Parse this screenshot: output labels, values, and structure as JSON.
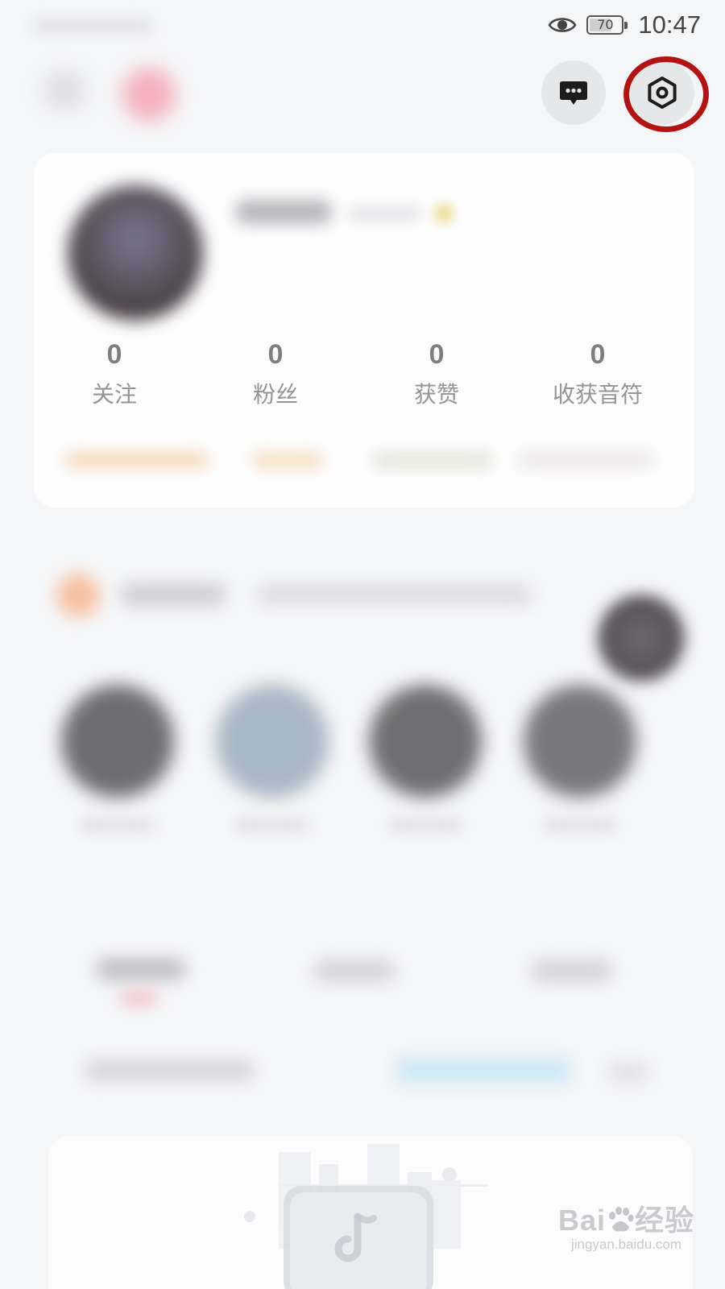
{
  "status_bar": {
    "battery_level": "70",
    "battery_fraction": 0.7,
    "time": "10:47",
    "icons": [
      "eye-icon",
      "battery-icon"
    ]
  },
  "header": {
    "message_button_icon": "chat-bubble-icon",
    "settings_button_icon": "settings-hexagon-icon",
    "highlight": "settings-button"
  },
  "profile": {
    "stats": [
      {
        "value": "0",
        "label": "关注"
      },
      {
        "value": "0",
        "label": "粉丝"
      },
      {
        "value": "0",
        "label": "获赞"
      },
      {
        "value": "0",
        "label": "收获音符"
      }
    ]
  },
  "watermark": {
    "brand": "Bai",
    "brand_suffix": "经验",
    "url": "jingyan.baidu.com"
  },
  "colors": {
    "highlight_ring": "#b51212",
    "background": "#f5f6f8",
    "card": "#fdfdfe"
  }
}
